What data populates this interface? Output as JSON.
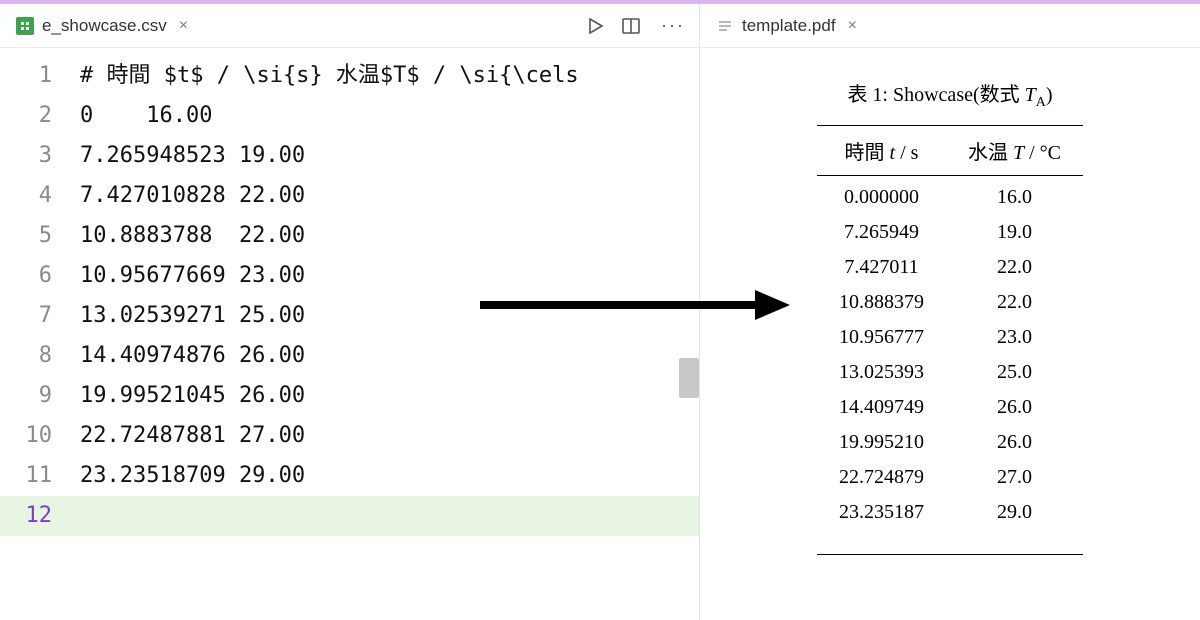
{
  "left_tab": {
    "filename": "e_showcase.csv"
  },
  "right_tab": {
    "filename": "template.pdf"
  },
  "editor": {
    "lines": [
      {
        "n": "1",
        "text": "# 時間 $t$ / \\si{s} 水温$T$ / \\si{\\cels"
      },
      {
        "n": "2",
        "text": "0    16.00"
      },
      {
        "n": "3",
        "text": "7.265948523 19.00"
      },
      {
        "n": "4",
        "text": "7.427010828 22.00"
      },
      {
        "n": "5",
        "text": "10.8883788  22.00"
      },
      {
        "n": "6",
        "text": "10.95677669 23.00"
      },
      {
        "n": "7",
        "text": "13.02539271 25.00"
      },
      {
        "n": "8",
        "text": "14.40974876 26.00"
      },
      {
        "n": "9",
        "text": "19.99521045 26.00"
      },
      {
        "n": "10",
        "text": "22.72487881 27.00"
      },
      {
        "n": "11",
        "text": "23.23518709 29.00"
      },
      {
        "n": "12",
        "text": ""
      }
    ]
  },
  "pdf": {
    "caption_prefix": "表 1:  Showcase(数式 ",
    "caption_var": "T",
    "caption_sub": "A",
    "caption_suffix": ")",
    "head_time_jp": "時間 ",
    "head_time_var": "t",
    "head_time_unit": " / s",
    "head_temp_jp": "水温 ",
    "head_temp_var": "T",
    "head_temp_unit": " / °C",
    "rows": [
      {
        "t": "0.000000",
        "T": "16.0"
      },
      {
        "t": "7.265949",
        "T": "19.0"
      },
      {
        "t": "7.427011",
        "T": "22.0"
      },
      {
        "t": "10.888379",
        "T": "22.0"
      },
      {
        "t": "10.956777",
        "T": "23.0"
      },
      {
        "t": "13.025393",
        "T": "25.0"
      },
      {
        "t": "14.409749",
        "T": "26.0"
      },
      {
        "t": "19.995210",
        "T": "26.0"
      },
      {
        "t": "22.724879",
        "T": "27.0"
      },
      {
        "t": "23.235187",
        "T": "29.0"
      }
    ]
  },
  "chart_data": {
    "type": "table",
    "title": "表 1: Showcase(数式 T_A)",
    "columns": [
      "時間 t / s",
      "水温 T / °C"
    ],
    "series": [
      {
        "name": "時間 t / s",
        "values": [
          0.0,
          7.265949,
          7.427011,
          10.888379,
          10.956777,
          13.025393,
          14.409749,
          19.99521,
          22.724879,
          23.235187
        ]
      },
      {
        "name": "水温 T / °C",
        "values": [
          16.0,
          19.0,
          22.0,
          22.0,
          23.0,
          25.0,
          26.0,
          26.0,
          27.0,
          29.0
        ]
      }
    ]
  }
}
